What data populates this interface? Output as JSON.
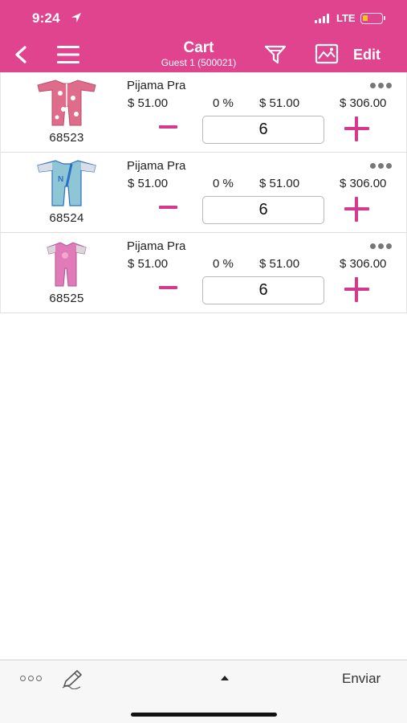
{
  "status_bar": {
    "time": "9:24",
    "network": "LTE",
    "battery_level": 0.2,
    "location_icon": "location-arrow-icon"
  },
  "nav": {
    "title": "Cart",
    "subtitle": "Guest 1 (500021)",
    "edit_label": "Edit",
    "icons": [
      "back-chevron-icon",
      "hamburger-menu-icon",
      "filter-icon",
      "image-icon"
    ]
  },
  "cart": {
    "items": [
      {
        "code": "68523",
        "name": "Pijama Pra",
        "price": "$ 51.00",
        "discount": "0 %",
        "net": "$ 51.00",
        "total": "$ 306.00",
        "qty": "6",
        "colors": {
          "main": "#e06c8c",
          "accent": "#ffffff"
        }
      },
      {
        "code": "68524",
        "name": "Pijama Pra",
        "price": "$ 51.00",
        "discount": "0 %",
        "net": "$ 51.00",
        "total": "$ 306.00",
        "qty": "6",
        "colors": {
          "main": "#8fc6d6",
          "accent": "#2f6fc2"
        }
      },
      {
        "code": "68525",
        "name": "Pijama Pra",
        "price": "$ 51.00",
        "discount": "0 %",
        "net": "$ 51.00",
        "total": "$ 306.00",
        "qty": "6",
        "colors": {
          "main": "#e07ab8",
          "accent": "#d8d8d8"
        }
      }
    ]
  },
  "footer": {
    "send_label": "Enviar",
    "icons": [
      "more-options-icon",
      "pen-icon",
      "caret-up-icon"
    ]
  },
  "colors": {
    "brand": "#e0448f",
    "accent": "#d6388c",
    "battery": "#f6c51b"
  }
}
